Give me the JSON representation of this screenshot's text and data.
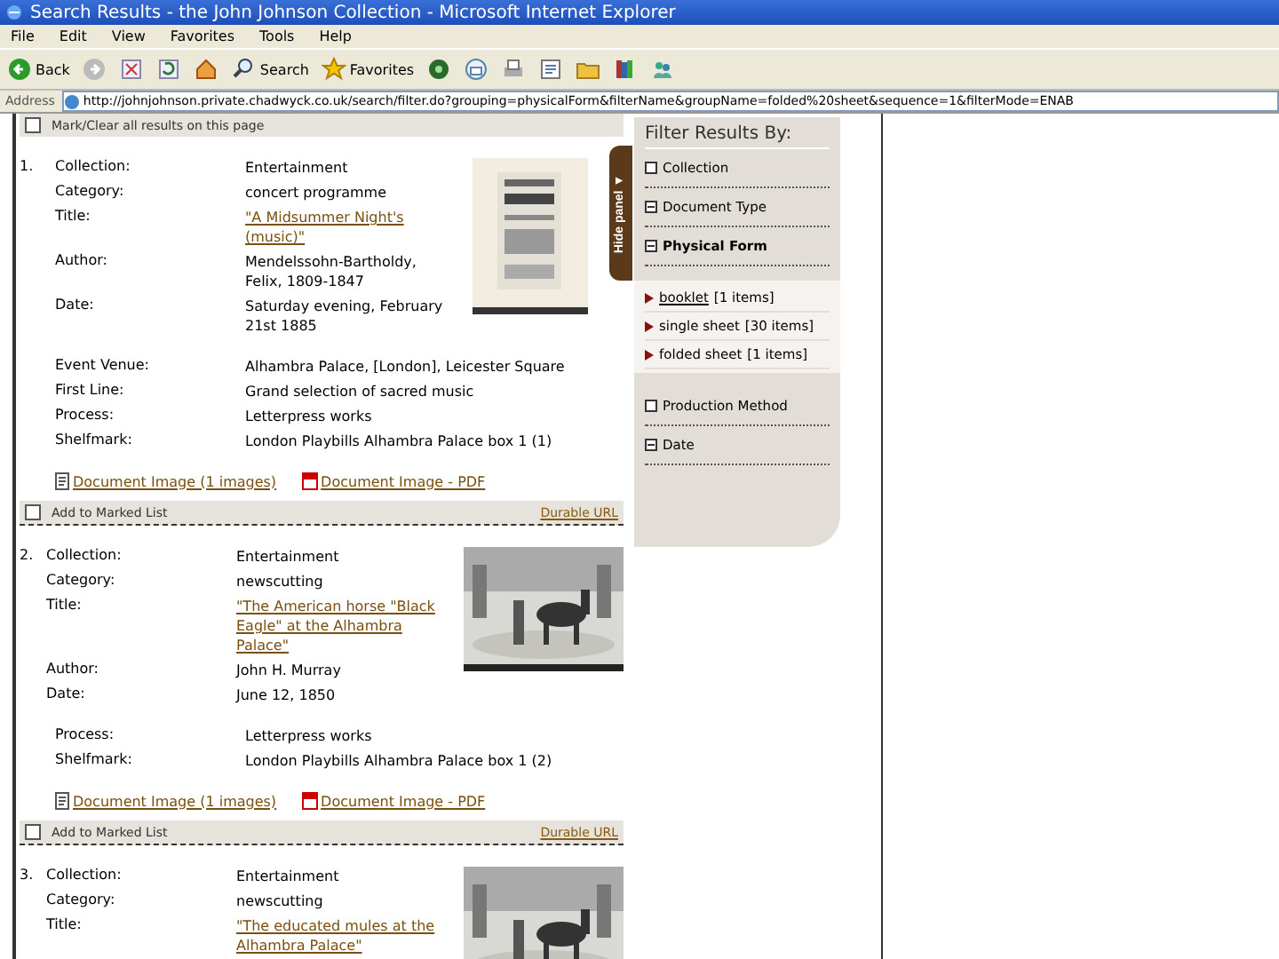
{
  "window": {
    "title": "Search Results - the John Johnson Collection - Microsoft Internet Explorer"
  },
  "menu": [
    "File",
    "Edit",
    "View",
    "Favorites",
    "Tools",
    "Help"
  ],
  "toolbar": [
    {
      "kind": "back",
      "label": "Back"
    },
    {
      "kind": "forward"
    },
    {
      "kind": "stop"
    },
    {
      "kind": "refresh"
    },
    {
      "kind": "home"
    },
    {
      "kind": "search",
      "label": "Search"
    },
    {
      "kind": "favorites",
      "label": "Favorites"
    },
    {
      "kind": "media"
    },
    {
      "kind": "mail"
    },
    {
      "kind": "print"
    },
    {
      "kind": "edit"
    },
    {
      "kind": "folder"
    },
    {
      "kind": "books"
    },
    {
      "kind": "people"
    }
  ],
  "address": {
    "label": "Address",
    "value": "http://johnjohnson.private.chadwyck.co.uk/search/filter.do?grouping=physicalForm&filterName&groupName=folded%20sheet&sequence=1&filterMode=ENAB"
  },
  "mark_all": {
    "label": "Mark/Clear all results on this page",
    "checked": false
  },
  "results": [
    {
      "number": "1.",
      "fields": [
        {
          "label": "Collection:",
          "value": "Entertainment",
          "kind": "text"
        },
        {
          "label": "Category:",
          "value": "concert programme",
          "kind": "text"
        },
        {
          "label": "Title:",
          "value": "\"A Midsummer Night's (music)\"",
          "kind": "link"
        },
        {
          "label": "Author:",
          "value": "Mendelssohn-Bartholdy, Felix, 1809-1847",
          "kind": "text"
        },
        {
          "label": "Date:",
          "value": "Saturday evening, February 21st 1885",
          "kind": "text"
        }
      ],
      "more_fields": [
        {
          "label": "Event Venue:",
          "value": "Alhambra Palace, [London], Leicester Square"
        },
        {
          "label": "First Line:",
          "value": "Grand selection of sacred music"
        },
        {
          "label": "Process:",
          "value": "Letterpress works"
        },
        {
          "label": "Shelfmark:",
          "value": "London Playbills Alhambra Palace box 1 (1)"
        }
      ],
      "links": [
        {
          "label": "Document Image (1 images)"
        },
        {
          "kind": "pdf",
          "label": "Document Image - PDF"
        }
      ],
      "marked_label": "Add to Marked List",
      "marked": false,
      "durable": "Durable URL"
    },
    {
      "number": "2.",
      "fields": [
        {
          "label": "Collection:",
          "value": "Entertainment",
          "kind": "text"
        },
        {
          "label": "Category:",
          "value": "newscutting",
          "kind": "text"
        },
        {
          "label": "Title:",
          "value": "\"The American horse \"Black Eagle\" at the Alhambra Palace\"",
          "kind": "link"
        },
        {
          "label": "Author:",
          "value": "John H. Murray",
          "kind": "text"
        },
        {
          "label": "Date:",
          "value": "June 12, 1850",
          "kind": "text"
        }
      ],
      "more_fields": [
        {
          "label": "Process:",
          "value": "Letterpress works"
        },
        {
          "label": "Shelfmark:",
          "value": "London Playbills Alhambra Palace box 1 (2)"
        }
      ],
      "links": [
        {
          "label": "Document Image (1 images)"
        },
        {
          "kind": "pdf",
          "label": "Document Image - PDF"
        }
      ],
      "marked_label": "Add to Marked List",
      "marked": false,
      "durable": "Durable URL"
    },
    {
      "number": "3.",
      "fields": [
        {
          "label": "Collection:",
          "value": "Entertainment",
          "kind": "text"
        },
        {
          "label": "Category:",
          "value": "newscutting",
          "kind": "text"
        },
        {
          "label": "Title:",
          "value": "\"The educated mules at the Alhambra Palace\"",
          "kind": "link"
        }
      ]
    }
  ],
  "hide_panel": "Hide panel ▼",
  "filter": {
    "title": "Filter Results By:",
    "groups": [
      {
        "label": "Collection",
        "expanded": false
      },
      {
        "label": "Document Type",
        "expanded": true
      },
      {
        "label": "Physical Form",
        "expanded": true,
        "items": [
          {
            "name": "booklet",
            "count": "[1 items]",
            "selected": true
          },
          {
            "name": "single sheet",
            "count": "[30 items]",
            "selected": false
          },
          {
            "name": "folded sheet",
            "count": "[1 items]",
            "selected": false
          }
        ]
      },
      {
        "label": "Production Method",
        "expanded": false
      },
      {
        "label": "Date",
        "expanded": true
      }
    ]
  }
}
